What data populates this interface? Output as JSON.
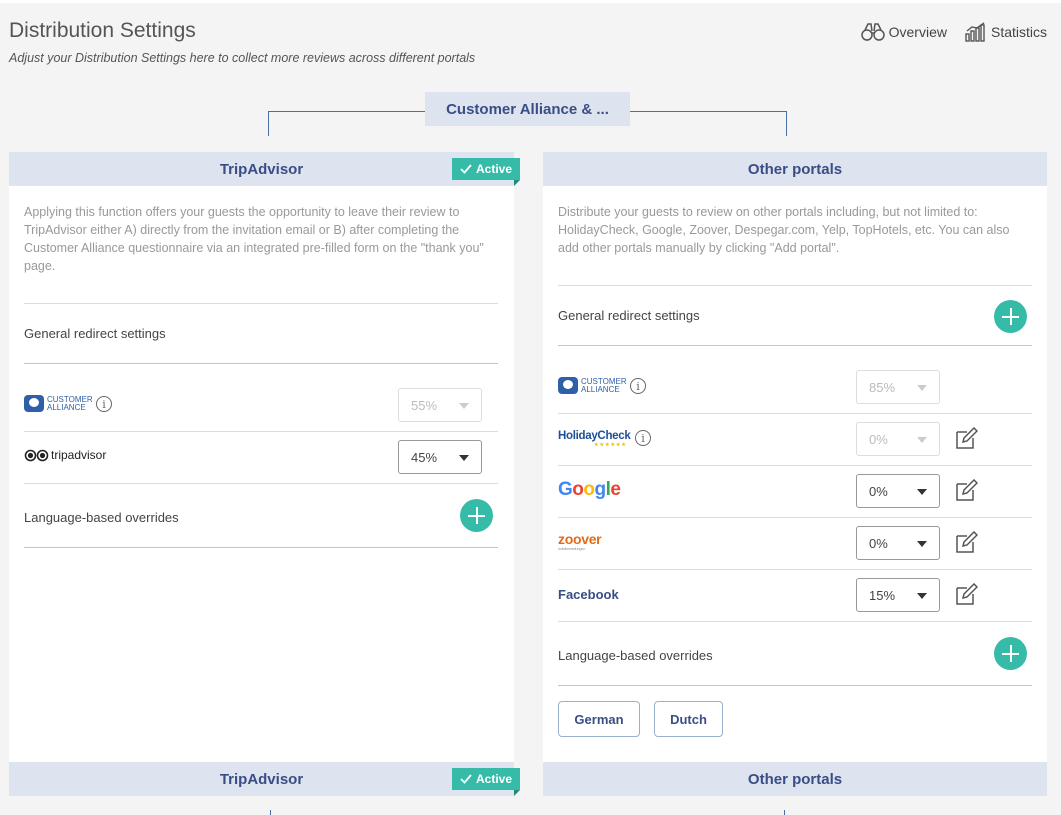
{
  "header": {
    "title": "Distribution Settings",
    "subtitle": "Adjust your Distribution Settings here to collect more reviews across different portals",
    "links": [
      {
        "label": "Overview",
        "icon": "binoculars-icon"
      },
      {
        "label": "Statistics",
        "icon": "bar-chart-icon"
      }
    ]
  },
  "tree": {
    "root_label": "Customer Alliance & ..."
  },
  "tripadvisor_panel": {
    "title": "TripAdvisor",
    "badge": "Active",
    "description": "Applying this function offers your guests the opportunity to leave their review to TripAdvisor either A) directly from the invitation email or B) after completing the Customer Alliance questionnaire via an integrated pre-filled form on the \"thank you\" page.",
    "general_redirect_label": "General redirect settings",
    "rows": [
      {
        "portal": "Customer Alliance",
        "logo_text": "CUSTOMER ALLIANCE",
        "value": "55%",
        "disabled": true
      },
      {
        "portal": "Tripadvisor",
        "logo_text": "tripadvisor",
        "value": "45%",
        "disabled": false
      }
    ],
    "language_overrides_label": "Language-based overrides"
  },
  "other_panel": {
    "title": "Other portals",
    "description": "Distribute your guests to review on other portals including, but not limited to: HolidayCheck, Google, Zoover, Despegar.com, Yelp, TopHotels, etc. You can also add other portals manually by clicking \"Add portal\".",
    "general_redirect_label": "General redirect settings",
    "rows": [
      {
        "portal": "Customer Alliance",
        "logo_text": "CUSTOMER ALLIANCE",
        "value": "85%",
        "disabled": true
      },
      {
        "portal": "HolidayCheck",
        "logo_text": "HolidayCheck",
        "value": "0%",
        "disabled": true
      },
      {
        "portal": "Google",
        "logo_text": "Google",
        "value": "0%",
        "disabled": false
      },
      {
        "portal": "Zoover",
        "logo_text": "zoover",
        "logo_subtext": "hotelbewertungen",
        "value": "0%",
        "disabled": false
      },
      {
        "portal": "Facebook",
        "logo_text": "Facebook",
        "value": "15%",
        "disabled": false
      }
    ],
    "language_overrides_label": "Language-based overrides",
    "languages": [
      "German",
      "Dutch"
    ]
  },
  "bottom": {
    "tripadvisor_title": "TripAdvisor",
    "tripadvisor_badge": "Active",
    "other_title": "Other portals"
  },
  "colors": {
    "accent_teal": "#36bba8",
    "header_bg": "#dde3ef",
    "heading_blue": "#3a4e86",
    "tree_line": "#4a6fa5"
  }
}
